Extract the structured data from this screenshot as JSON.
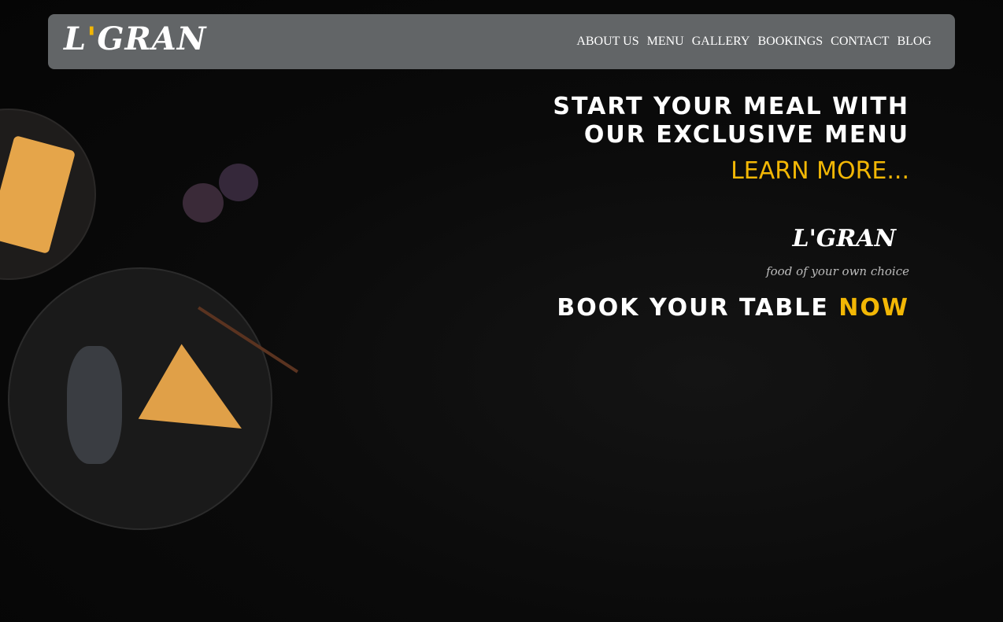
{
  "nav": {
    "logo_prefix": "L",
    "logo_apostrophe": "'",
    "logo_suffix": "GRAN",
    "items": [
      "ABOUT US",
      "MENU",
      "GALLERY",
      "BOOKINGS",
      "CONTACT",
      "BLOG"
    ]
  },
  "hero": {
    "headline_line1": "START YOUR MEAL WITH",
    "headline_line2": "OUR EXCLUSIVE MENU",
    "learn_more": "LEARN MORE...",
    "brand": "L'GRAN",
    "tagline": "food of your own choice",
    "book_text": "BOOK YOUR TABLE",
    "book_highlight": "NOW"
  },
  "colors": {
    "accent": "#f2b705",
    "nav_bg": "#626567"
  }
}
